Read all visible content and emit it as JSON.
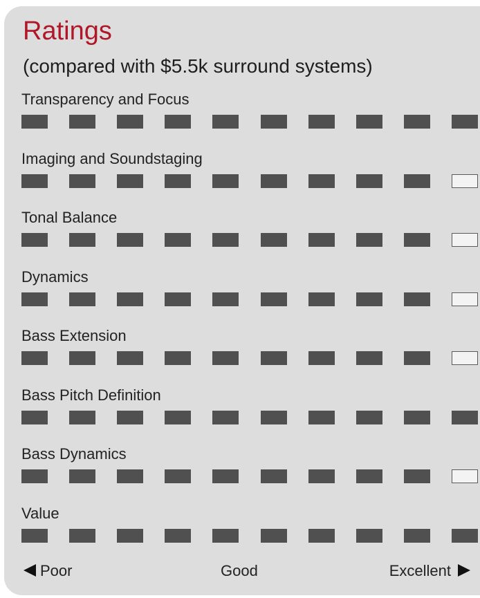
{
  "title": "Ratings",
  "subtitle": "(compared with $5.5k surround systems)",
  "colors": {
    "title": "#b0182a",
    "background": "#dddddd",
    "filled_square": "#505050",
    "empty_square": "#f3f3f3"
  },
  "chart_data": {
    "type": "bar",
    "title": "Ratings",
    "subtitle": "(compared with $5.5k surround systems)",
    "max_value": 10,
    "categories": [
      "Transparency and Focus",
      "Imaging and Soundstaging",
      "Tonal Balance",
      "Dynamics",
      "Bass Extension",
      "Bass Pitch Definition",
      "Bass Dynamics",
      "Value"
    ],
    "values": [
      10,
      9,
      9,
      9,
      9,
      10,
      9,
      10
    ],
    "scale_labels": {
      "low": "Poor",
      "mid": "Good",
      "high": "Excellent"
    }
  }
}
